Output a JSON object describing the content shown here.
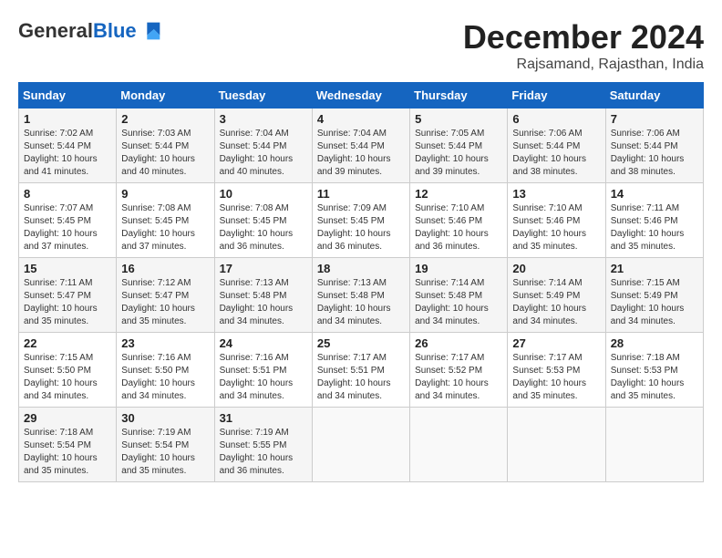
{
  "logo": {
    "general": "General",
    "blue": "Blue"
  },
  "title": "December 2024",
  "subtitle": "Rajsamand, Rajasthan, India",
  "days_of_week": [
    "Sunday",
    "Monday",
    "Tuesday",
    "Wednesday",
    "Thursday",
    "Friday",
    "Saturday"
  ],
  "weeks": [
    [
      {
        "day": 1,
        "info": "Sunrise: 7:02 AM\nSunset: 5:44 PM\nDaylight: 10 hours\nand 41 minutes."
      },
      {
        "day": 2,
        "info": "Sunrise: 7:03 AM\nSunset: 5:44 PM\nDaylight: 10 hours\nand 40 minutes."
      },
      {
        "day": 3,
        "info": "Sunrise: 7:04 AM\nSunset: 5:44 PM\nDaylight: 10 hours\nand 40 minutes."
      },
      {
        "day": 4,
        "info": "Sunrise: 7:04 AM\nSunset: 5:44 PM\nDaylight: 10 hours\nand 39 minutes."
      },
      {
        "day": 5,
        "info": "Sunrise: 7:05 AM\nSunset: 5:44 PM\nDaylight: 10 hours\nand 39 minutes."
      },
      {
        "day": 6,
        "info": "Sunrise: 7:06 AM\nSunset: 5:44 PM\nDaylight: 10 hours\nand 38 minutes."
      },
      {
        "day": 7,
        "info": "Sunrise: 7:06 AM\nSunset: 5:44 PM\nDaylight: 10 hours\nand 38 minutes."
      }
    ],
    [
      {
        "day": 8,
        "info": "Sunrise: 7:07 AM\nSunset: 5:45 PM\nDaylight: 10 hours\nand 37 minutes."
      },
      {
        "day": 9,
        "info": "Sunrise: 7:08 AM\nSunset: 5:45 PM\nDaylight: 10 hours\nand 37 minutes."
      },
      {
        "day": 10,
        "info": "Sunrise: 7:08 AM\nSunset: 5:45 PM\nDaylight: 10 hours\nand 36 minutes."
      },
      {
        "day": 11,
        "info": "Sunrise: 7:09 AM\nSunset: 5:45 PM\nDaylight: 10 hours\nand 36 minutes."
      },
      {
        "day": 12,
        "info": "Sunrise: 7:10 AM\nSunset: 5:46 PM\nDaylight: 10 hours\nand 36 minutes."
      },
      {
        "day": 13,
        "info": "Sunrise: 7:10 AM\nSunset: 5:46 PM\nDaylight: 10 hours\nand 35 minutes."
      },
      {
        "day": 14,
        "info": "Sunrise: 7:11 AM\nSunset: 5:46 PM\nDaylight: 10 hours\nand 35 minutes."
      }
    ],
    [
      {
        "day": 15,
        "info": "Sunrise: 7:11 AM\nSunset: 5:47 PM\nDaylight: 10 hours\nand 35 minutes."
      },
      {
        "day": 16,
        "info": "Sunrise: 7:12 AM\nSunset: 5:47 PM\nDaylight: 10 hours\nand 35 minutes."
      },
      {
        "day": 17,
        "info": "Sunrise: 7:13 AM\nSunset: 5:48 PM\nDaylight: 10 hours\nand 34 minutes."
      },
      {
        "day": 18,
        "info": "Sunrise: 7:13 AM\nSunset: 5:48 PM\nDaylight: 10 hours\nand 34 minutes."
      },
      {
        "day": 19,
        "info": "Sunrise: 7:14 AM\nSunset: 5:48 PM\nDaylight: 10 hours\nand 34 minutes."
      },
      {
        "day": 20,
        "info": "Sunrise: 7:14 AM\nSunset: 5:49 PM\nDaylight: 10 hours\nand 34 minutes."
      },
      {
        "day": 21,
        "info": "Sunrise: 7:15 AM\nSunset: 5:49 PM\nDaylight: 10 hours\nand 34 minutes."
      }
    ],
    [
      {
        "day": 22,
        "info": "Sunrise: 7:15 AM\nSunset: 5:50 PM\nDaylight: 10 hours\nand 34 minutes."
      },
      {
        "day": 23,
        "info": "Sunrise: 7:16 AM\nSunset: 5:50 PM\nDaylight: 10 hours\nand 34 minutes."
      },
      {
        "day": 24,
        "info": "Sunrise: 7:16 AM\nSunset: 5:51 PM\nDaylight: 10 hours\nand 34 minutes."
      },
      {
        "day": 25,
        "info": "Sunrise: 7:17 AM\nSunset: 5:51 PM\nDaylight: 10 hours\nand 34 minutes."
      },
      {
        "day": 26,
        "info": "Sunrise: 7:17 AM\nSunset: 5:52 PM\nDaylight: 10 hours\nand 34 minutes."
      },
      {
        "day": 27,
        "info": "Sunrise: 7:17 AM\nSunset: 5:53 PM\nDaylight: 10 hours\nand 35 minutes."
      },
      {
        "day": 28,
        "info": "Sunrise: 7:18 AM\nSunset: 5:53 PM\nDaylight: 10 hours\nand 35 minutes."
      }
    ],
    [
      {
        "day": 29,
        "info": "Sunrise: 7:18 AM\nSunset: 5:54 PM\nDaylight: 10 hours\nand 35 minutes."
      },
      {
        "day": 30,
        "info": "Sunrise: 7:19 AM\nSunset: 5:54 PM\nDaylight: 10 hours\nand 35 minutes."
      },
      {
        "day": 31,
        "info": "Sunrise: 7:19 AM\nSunset: 5:55 PM\nDaylight: 10 hours\nand 36 minutes."
      },
      null,
      null,
      null,
      null
    ]
  ]
}
